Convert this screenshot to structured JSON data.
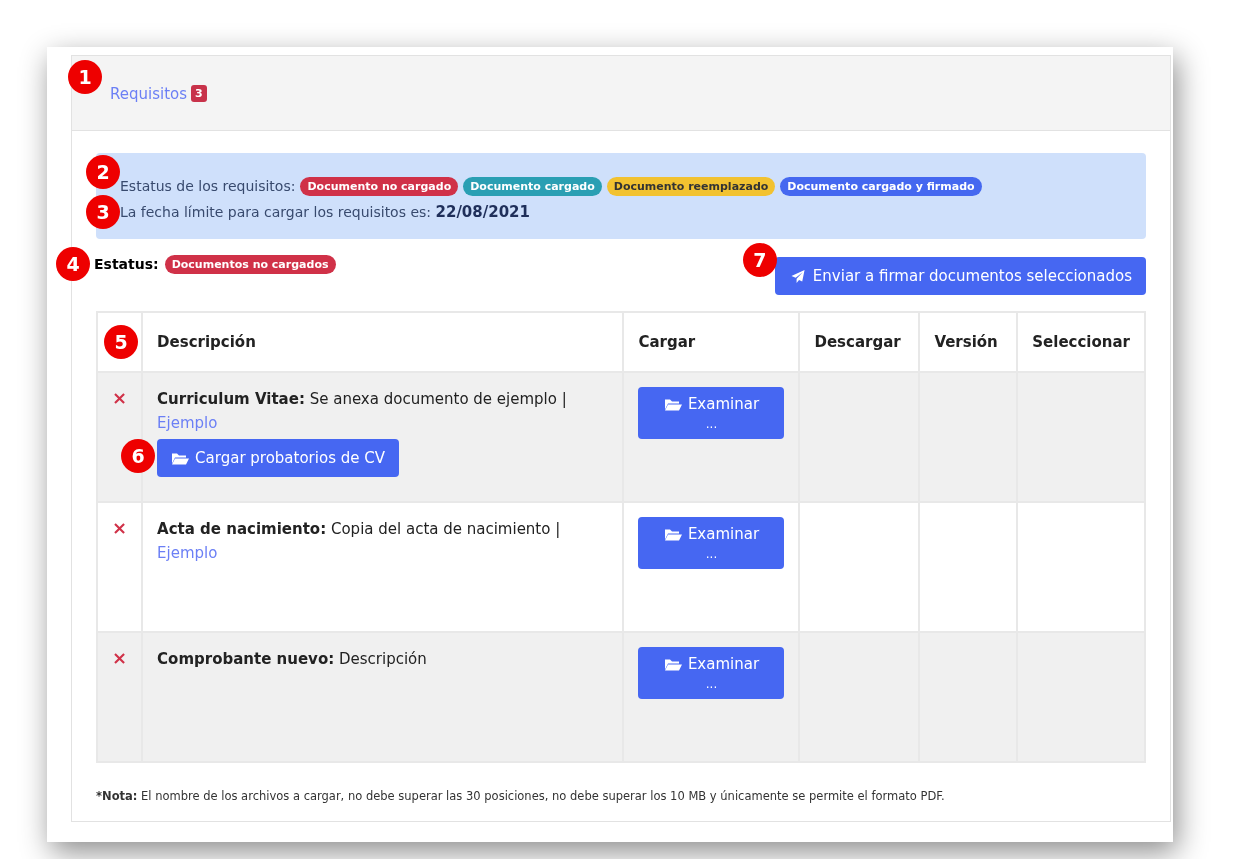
{
  "tab": {
    "label": "Requisitos",
    "count": "3",
    "callout": "1"
  },
  "legend": {
    "label": "Estatus de los requisitos:",
    "callout": "2",
    "badges": [
      {
        "text": "Documento no cargado",
        "color": "#d03148"
      },
      {
        "text": "Documento cargado",
        "color": "#2a9fb3"
      },
      {
        "text": "Documento reemplazado",
        "color": "#f2c230"
      },
      {
        "text": "Documento cargado y firmado",
        "color": "#4568f0"
      }
    ]
  },
  "deadline": {
    "text": "La fecha límite para cargar los requisitos es:",
    "date": "22/08/2021",
    "callout": "3"
  },
  "status": {
    "label": "Estatus:",
    "badge": "Documentos no cargados",
    "color": "#d03148",
    "callout": "4"
  },
  "send_button": {
    "label": "Enviar a firmar documentos seleccionados",
    "callout": "7"
  },
  "table": {
    "callout": "5",
    "columns": [
      "Descripción",
      "Cargar",
      "Descargar",
      "Versión",
      "Seleccionar"
    ],
    "rows": [
      {
        "mark": "×",
        "title": "Curriculum Vitae:",
        "description": "Se anexa documento de ejemplo |",
        "link": "Ejemplo",
        "extra_button": {
          "label": "Cargar probatorios de CV",
          "callout": "6"
        },
        "upload": {
          "label": "Examinar",
          "sub": "..."
        }
      },
      {
        "mark": "×",
        "title": "Acta de nacimiento:",
        "description": "Copia del acta de nacimiento |",
        "link": "Ejemplo",
        "upload": {
          "label": "Examinar",
          "sub": "..."
        }
      },
      {
        "mark": "×",
        "title": "Comprobante nuevo:",
        "description": "Descripción",
        "upload": {
          "label": "Examinar",
          "sub": "..."
        }
      }
    ]
  },
  "note": {
    "label": "*Nota:",
    "text": "El nombre de los archivos a cargar, no debe superar las 30 posiciones, no debe superar los 10 MB y únicamente se permite el formato PDF."
  }
}
